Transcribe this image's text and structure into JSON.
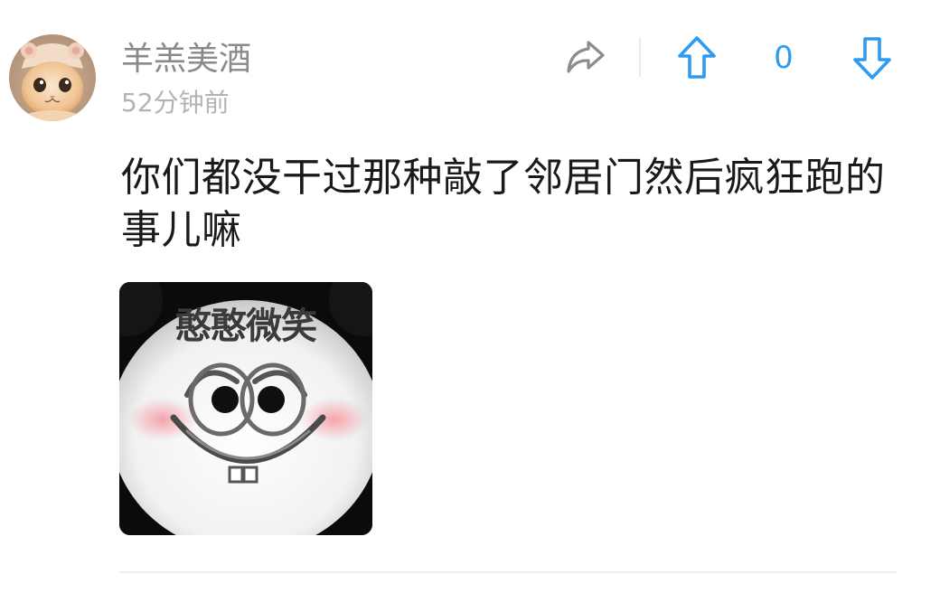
{
  "post": {
    "author": "羊羔美酒",
    "time": "52分钟前",
    "text": "你们都没干过那种敲了邻居门然后疯狂跑的事儿嘛",
    "image_caption": "憨憨微笑"
  },
  "actions": {
    "share_icon": "share-arrow-icon",
    "upvote_icon": "upvote-arrow-icon",
    "downvote_icon": "downvote-arrow-icon",
    "vote_count": "0"
  },
  "colors": {
    "accent": "#2e9bf0",
    "username": "#8a8a8a",
    "timestamp": "#b3b3b3",
    "text": "#1a1a1a",
    "icon_gray": "#8c8c8c"
  }
}
